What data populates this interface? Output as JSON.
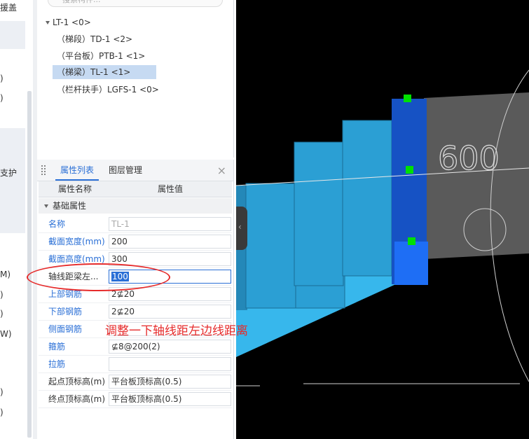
{
  "left_strip": {
    "fragments": [
      "援盖",
      ")",
      ")",
      "支护",
      "M)",
      ")",
      ")",
      "W)",
      ")",
      ")"
    ]
  },
  "tree": {
    "search_placeholder": "搜索构件...",
    "root": "LT-1 <0>",
    "children": [
      "（梯段）TD-1 <2>",
      "（平台板）PTB-1 <1>",
      "（梯梁）TL-1 <1>",
      "（栏杆扶手）LGFS-1 <0>"
    ],
    "selected_index": 2
  },
  "props": {
    "tabs": [
      "属性列表",
      "图层管理"
    ],
    "active_tab": 0,
    "close": "×",
    "col_name": "属性名称",
    "col_value": "属性值",
    "group": "基础属性",
    "rows": [
      {
        "name": "名称",
        "value": "TL-1"
      },
      {
        "name": "截面宽度(mm)",
        "value": "200"
      },
      {
        "name": "截面高度(mm)",
        "value": "300"
      },
      {
        "name": "轴线距梁左...",
        "value": "100"
      },
      {
        "name": "上部钢筋",
        "value": "2⊈20"
      },
      {
        "name": "下部钢筋",
        "value": "2⊈20"
      },
      {
        "name": "侧面钢筋",
        "value": ""
      },
      {
        "name": "箍筋",
        "value": "⊈8@200(2)"
      },
      {
        "name": "拉筋",
        "value": ""
      },
      {
        "name": "起点顶标高(m)",
        "value": "平台板顶标高(0.5)"
      },
      {
        "name": "终点顶标高(m)",
        "value": "平台板顶标高(0.5)"
      }
    ]
  },
  "annotation": {
    "text": "调整一下轴线距左边线距离",
    "color": "#e62b2b"
  },
  "viewport": {
    "dimension_label": "600",
    "handle_icon": "‹",
    "colors": {
      "stair_top": "#2b9fd4",
      "stair_side": "#2488b8",
      "ramp": "#37b7ec",
      "beam": "#1652c4",
      "beam_highlight": "#1e6ef5",
      "grip": "#00e000",
      "slab": "#5a5a5a"
    }
  }
}
